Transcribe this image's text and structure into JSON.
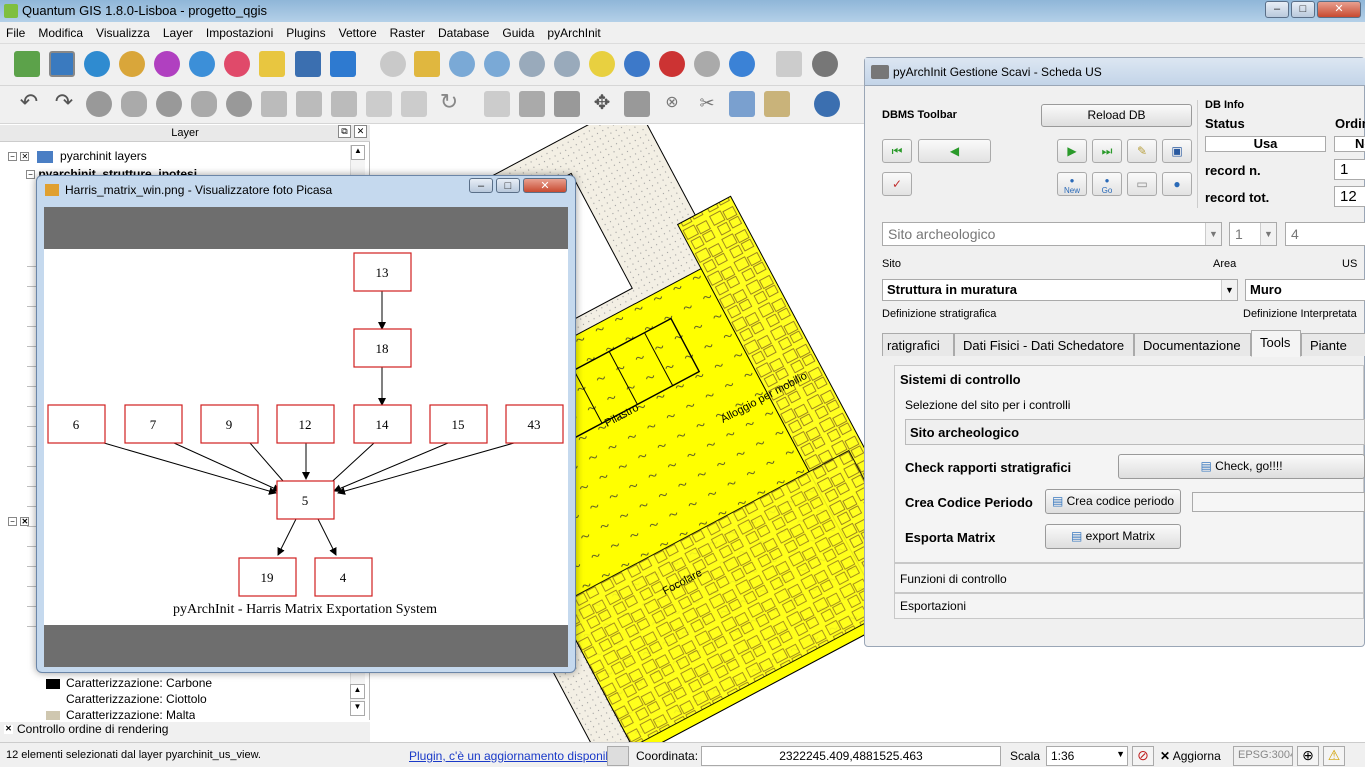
{
  "window": {
    "title": "Quantum GIS 1.8.0-Lisboa - progetto_qgis"
  },
  "menu": [
    "File",
    "Modifica",
    "Visualizza",
    "Layer",
    "Impostazioni",
    "Plugins",
    "Vettore",
    "Raster",
    "Database",
    "Guida",
    "pyArchInit"
  ],
  "layer_panel": {
    "header": "Layer",
    "root_group": "pyarchinit layers",
    "sub_layer": "pyarchinit_strutture_ipotesi",
    "legend_items": [
      "Caratterizzazione: Carbone",
      "Caratterizzazione: Ciottolo",
      "Caratterizzazione: Malta"
    ],
    "render_order": "Controllo ordine di rendering"
  },
  "picasa": {
    "title": "Harris_matrix_win.png - Visualizzatore foto Picasa",
    "caption": "pyArchInit - Harris Matrix Exportation System",
    "nodes": {
      "n13": "13",
      "n18": "18",
      "n6": "6",
      "n7": "7",
      "n9": "9",
      "n12": "12",
      "n14": "14",
      "n15": "15",
      "n43": "43",
      "n5": "5",
      "n19": "19",
      "n4": "4"
    }
  },
  "map": {
    "labels": {
      "pilastro": "Pilastro",
      "alloggio": "Alloggio per mobilio",
      "focolare": "Focolare"
    }
  },
  "pyarchinit": {
    "title": "pyArchInit Gestione Scavi - Scheda US",
    "dbms_toolbar": "DBMS Toolbar",
    "reload": "Reload DB",
    "db_info": "DB Info",
    "status_label": "Status",
    "status_value": "Usa",
    "ordin_label": "Ordin",
    "ordin_value": "No",
    "record_n_label": "record n.",
    "record_n": "1",
    "record_tot_label": "record tot.",
    "record_tot": "12",
    "new_label": "New",
    "go_label": "Go",
    "sito_value": "Sito archeologico",
    "area_value": "1",
    "us_value": "4",
    "sito_caption": "Sito",
    "area_caption": "Area",
    "us_caption": "US",
    "def_strat_value": "Struttura in muratura",
    "def_strat_caption": "Definizione stratigrafica",
    "def_interp_value": "Muro",
    "def_interp_caption": "Definizione Interpretata",
    "tabs": [
      "ratigrafici",
      "Dati Fisici - Dati Schedatore",
      "Documentazione",
      "Tools",
      "Piante"
    ],
    "group1_title": "Sistemi di controllo",
    "select_site_label": "Selezione del sito per i controlli",
    "select_site_value": "Sito archeologico",
    "check_label": "Check rapporti stratigrafici",
    "check_btn": "Check, go!!!!",
    "period_label": "Crea Codice Periodo",
    "period_btn": "Crea codice periodo",
    "export_label": "Esporta Matrix",
    "export_btn": "export Matrix",
    "group2_title": "Funzioni di controllo",
    "group3_title": "Esportazioni"
  },
  "statusbar": {
    "selection": "12 elementi selezionati dal layer pyarchinit_us_view.",
    "plugin_link": "Plugin, c'è un aggiornamento disponibile",
    "coord_label": "Coordinata:",
    "coord_value": "2322245.409,4881525.463",
    "scale_label": "Scala",
    "scale_value": "1:36",
    "update_label": "Aggiorna",
    "epsg": "EPSG:3004"
  }
}
